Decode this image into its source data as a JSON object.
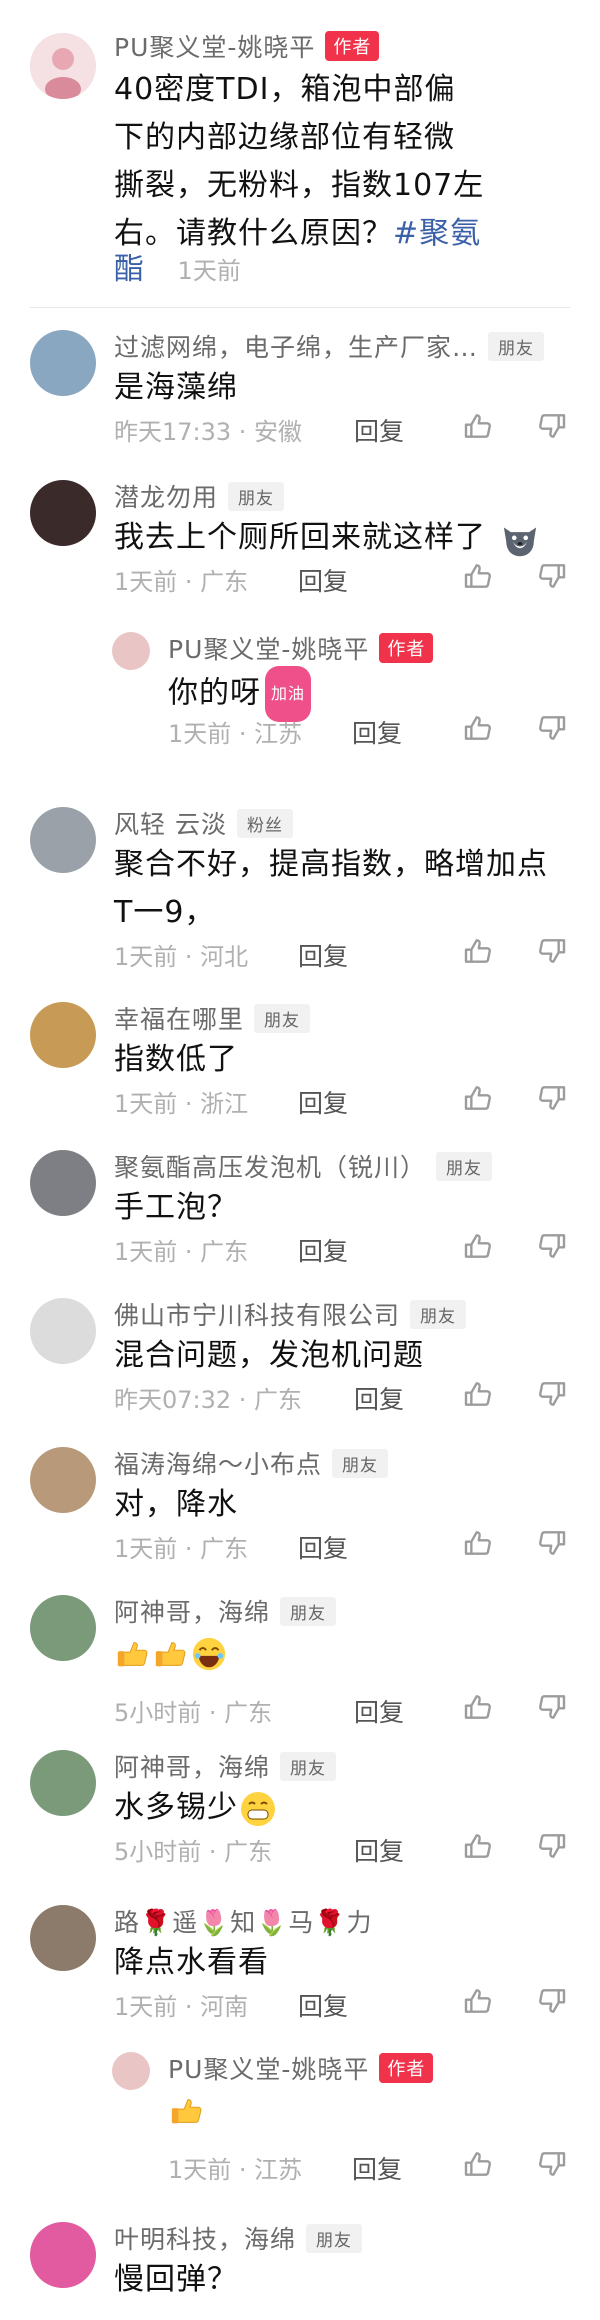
{
  "original_post": {
    "author": "PU聚义堂-姚晓平",
    "author_badge": "作者",
    "text_lines": [
      "40密度TDI，箱泡中部偏",
      "下的内部边缘部位有轻微",
      "撕裂，无粉料，指数107左",
      "右。请教什么原因？"
    ],
    "hashtag_part1": "#聚氨",
    "hashtag_part2": "酯",
    "time": "1天前"
  },
  "comments": [
    {
      "name": "过滤网绵，电子绵，生产厂家…",
      "badge": "朋友",
      "text": "是海藻绵",
      "meta": "昨天17:33 · 安徽",
      "reply": "回复",
      "avatar_bg": "#8aa7c2"
    },
    {
      "name": "潜龙勿用",
      "badge": "朋友",
      "text": "我去上个厕所回来就这样了",
      "meta": "1天前 · 广东",
      "reply": "回复",
      "avatar_bg": "#3a2a2a"
    },
    {
      "name": "PU聚义堂-姚晓平",
      "badge": "作者",
      "text": "你的呀",
      "meta": "1天前 · 江苏",
      "reply": "回复",
      "avatar_bg": "#e9c5c5",
      "sub": true
    },
    {
      "name": "风轻  云淡",
      "badge": "粉丝",
      "text": "聚合不好，提高指数，略增加点",
      "text2": "T一9，",
      "meta": "1天前 · 河北",
      "reply": "回复",
      "avatar_bg": "#9aa1a8"
    },
    {
      "name": "幸福在哪里",
      "badge": "朋友",
      "text": "指数低了",
      "meta": "1天前 · 浙江",
      "reply": "回复",
      "avatar_bg": "#c79a55"
    },
    {
      "name": "聚氨酯高压发泡机（锐川）",
      "badge": "朋友",
      "text": "手工泡？",
      "meta": "1天前 · 广东",
      "reply": "回复",
      "avatar_bg": "#7d7f84"
    },
    {
      "name": "佛山市宁川科技有限公司",
      "badge": "朋友",
      "text": "混合问题，发泡机问题",
      "meta": "昨天07:32 · 广东",
      "reply": "回复",
      "avatar_bg": "#dcdcdc"
    },
    {
      "name": "福涛海绵～小布点",
      "badge": "朋友",
      "text": "对，降水",
      "meta": "1天前 · 广东",
      "reply": "回复",
      "avatar_bg": "#b89a7a"
    },
    {
      "name": "阿神哥，海绵",
      "badge": "朋友",
      "text": "",
      "meta": "5小时前 · 广东",
      "reply": "回复",
      "avatar_bg": "#7a9a7a"
    },
    {
      "name": "阿神哥，海绵",
      "badge": "朋友",
      "text": "水多锡少",
      "meta": "5小时前 · 广东",
      "reply": "回复",
      "avatar_bg": "#7a9a7a"
    },
    {
      "name": "路🌹遥🌷知🌷马🌹力",
      "badge": "",
      "text": "降点水看看",
      "meta": "1天前 · 河南",
      "reply": "回复",
      "avatar_bg": "#8c7a6a"
    },
    {
      "name": "PU聚义堂-姚晓平",
      "badge": "作者",
      "text": "",
      "meta": "1天前 · 江苏",
      "reply": "回复",
      "avatar_bg": "#e9c5c5",
      "sub": true
    },
    {
      "name": "叶明科技，海绵",
      "badge": "朋友",
      "text": "慢回弹？",
      "meta": "",
      "reply": "",
      "avatar_bg": "#e25aa0"
    }
  ],
  "emoji_labels": {
    "jiayou": "加油"
  },
  "colors": {
    "author_badge": "#f0334b",
    "hashtag": "#3a61a8"
  }
}
